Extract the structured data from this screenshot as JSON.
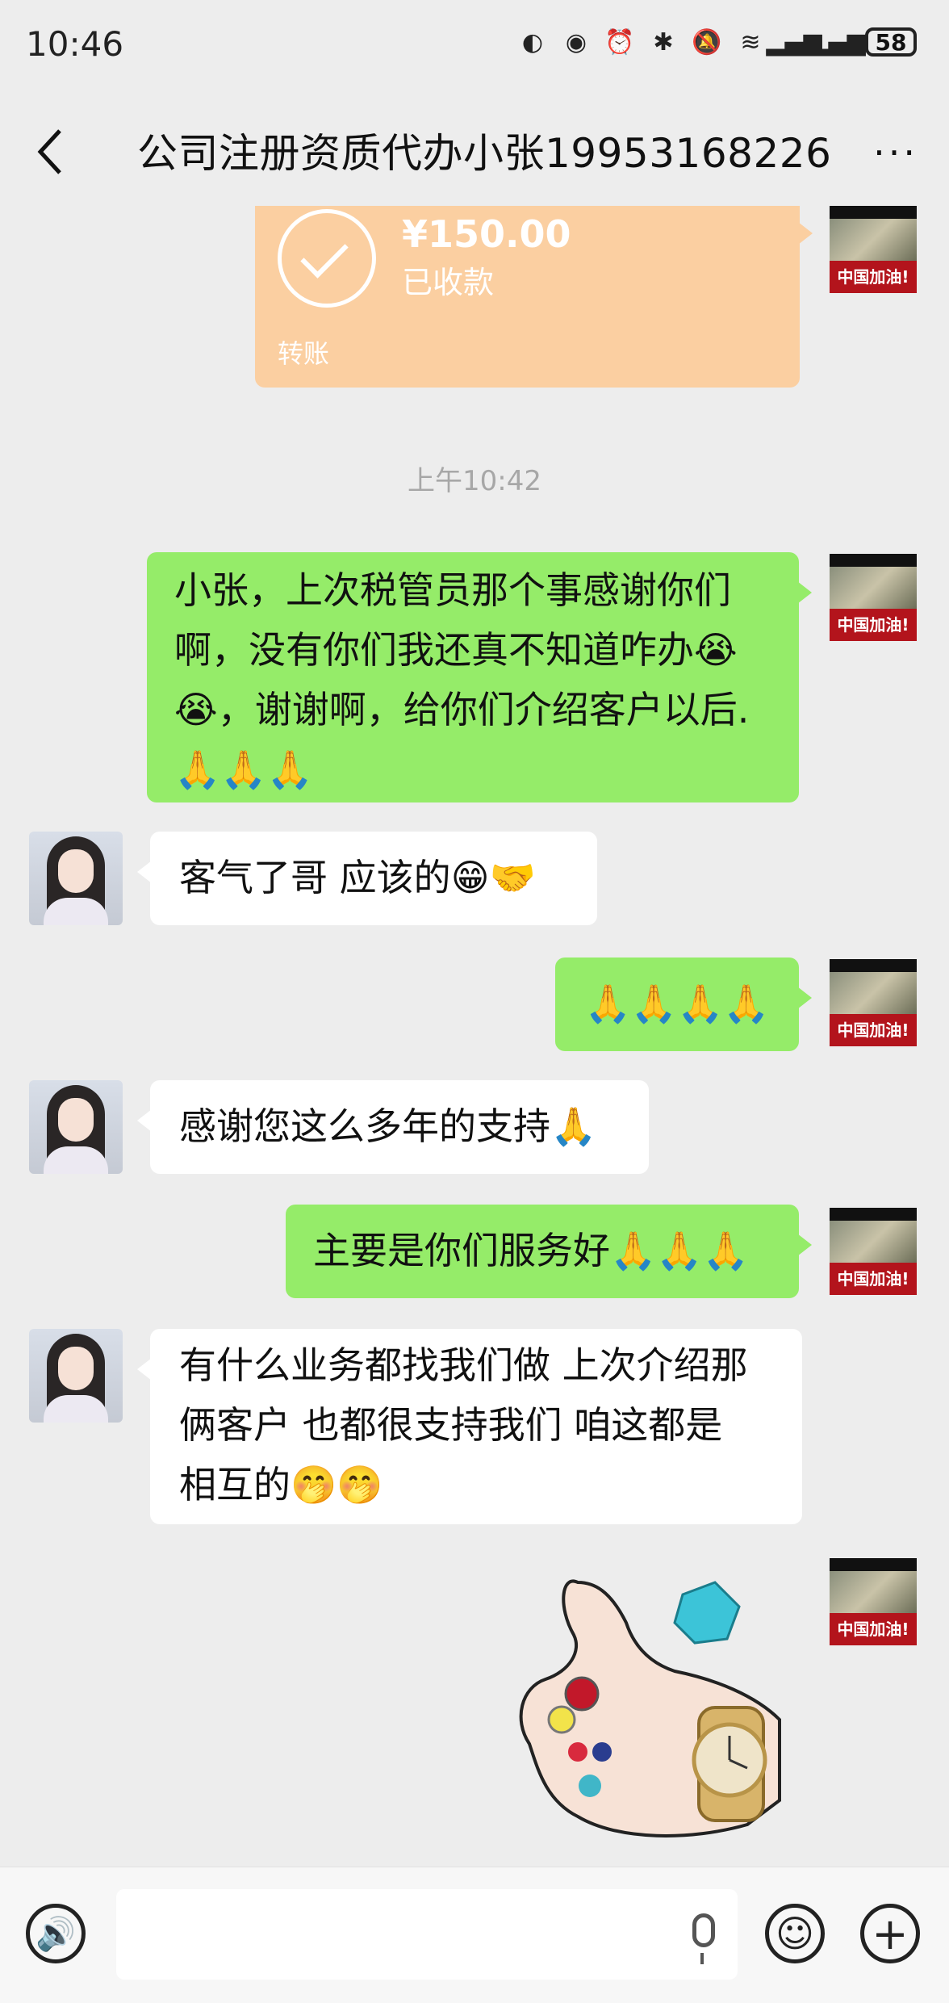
{
  "status_bar": {
    "time": "10:46",
    "battery": "58"
  },
  "header": {
    "title": "公司注册资质代办小张19953168226",
    "more": "···"
  },
  "transfer": {
    "amount": "¥150.00",
    "status": "已收款",
    "label": "转账"
  },
  "timestamp": "上午10:42",
  "avatar_banner": "中国加油!",
  "messages": [
    {
      "from": "me",
      "lines": [
        "小张，上次税管员那个事感谢你们",
        "啊，没有你们我还真不知道咋办😭",
        "😭，谢谢啊，给你们介绍客户以后.",
        "🙏🙏🙏"
      ]
    },
    {
      "from": "her",
      "lines": [
        "客气了哥  应该的😁🤝"
      ]
    },
    {
      "from": "me",
      "lines": [
        "🙏🙏🙏🙏"
      ]
    },
    {
      "from": "her",
      "lines": [
        "感谢您这么多年的支持🙏"
      ]
    },
    {
      "from": "me",
      "lines": [
        "主要是你们服务好🙏🙏🙏"
      ]
    },
    {
      "from": "her",
      "lines": [
        "有什么业务都找我们做  上次介绍那",
        "俩客户  也都很支持我们  咱这都是",
        "相互的🤭🤭"
      ]
    }
  ],
  "colors": {
    "background": "#ededed",
    "my_bubble": "#95ec69",
    "their_bubble": "#ffffff",
    "transfer_card": "#fbcfa1"
  }
}
